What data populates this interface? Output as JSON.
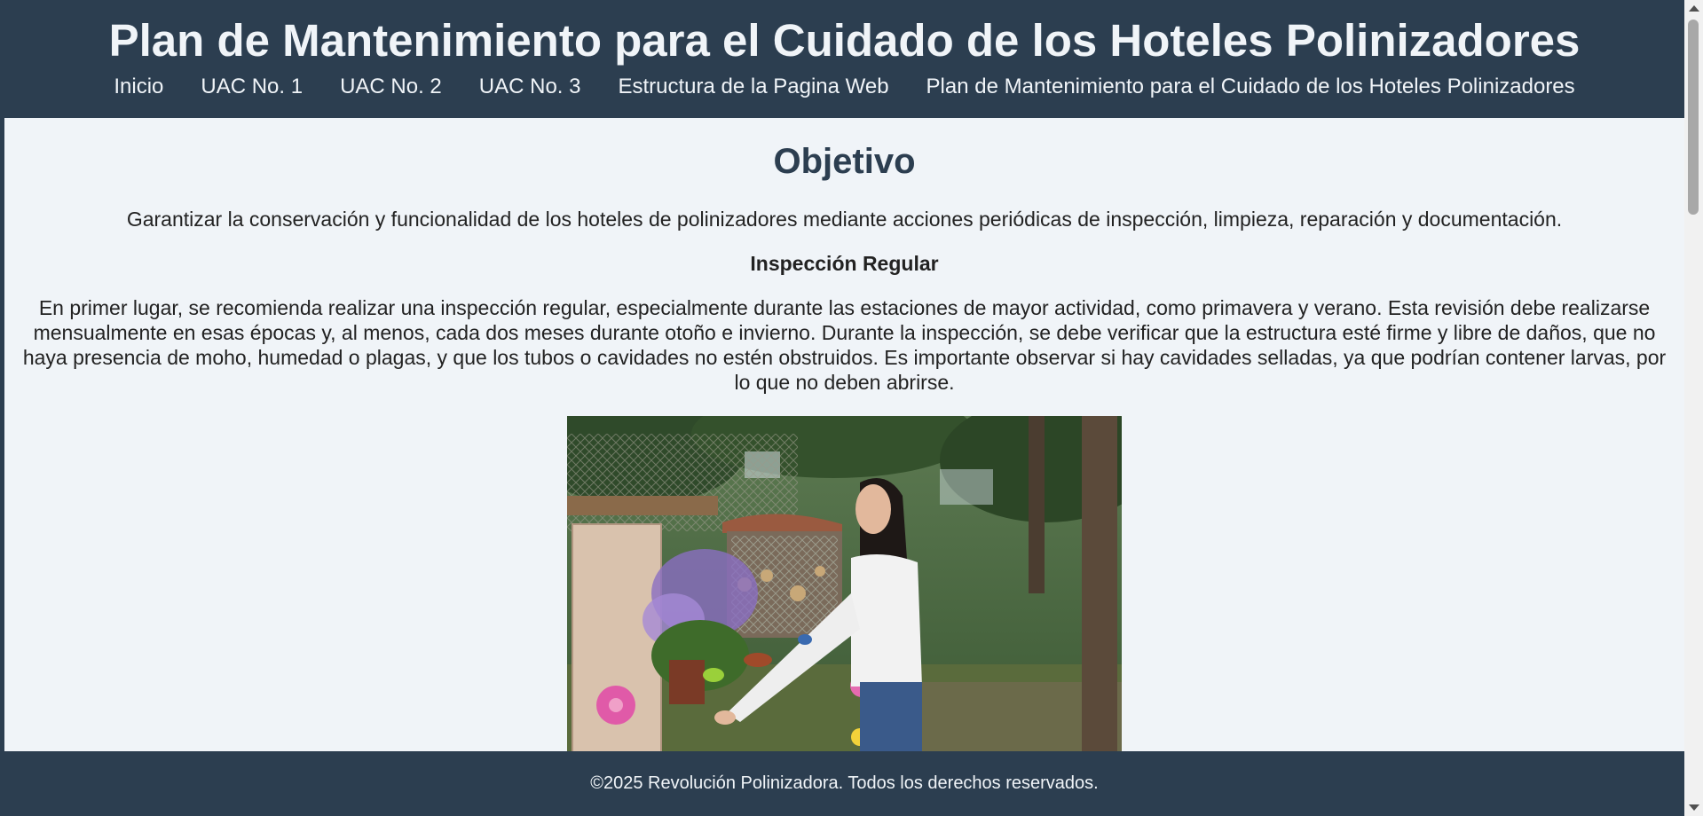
{
  "header": {
    "title": "Plan de Mantenimiento para el Cuidado de los Hoteles Polinizadores",
    "nav": [
      {
        "label": "Inicio"
      },
      {
        "label": "UAC No. 1"
      },
      {
        "label": "UAC No. 2"
      },
      {
        "label": "UAC No. 3"
      },
      {
        "label": "Estructura de la Pagina Web"
      },
      {
        "label": "Plan de Mantenimiento para el Cuidado de los Hoteles Polinizadores"
      }
    ]
  },
  "main": {
    "section_title": "Objetivo",
    "objective": "Garantizar la conservación y funcionalidad de los hoteles de polinizadores mediante acciones periódicas de inspección, limpieza, reparación y documentación.",
    "subheading": "Inspección Regular",
    "paragraph": "En primer lugar, se recomienda realizar una inspección regular, especialmente durante las estaciones de mayor actividad, como primavera y verano. Esta revisión debe realizarse mensualmente en esas épocas y, al menos, cada dos meses durante otoño e invierno. Durante la inspección, se debe verificar que la estructura esté firme y libre de daños, que no haya presencia de moho, humedad o plagas, y que los tubos o cavidades no estén obstruidos. Es importante observar si hay cavidades selladas, ya que podrían contener larvas, por lo que no deben abrirse."
  },
  "footer": {
    "text": "©2025 Revolución Polinizadora. Todos los derechos reservados."
  },
  "colors": {
    "header_bg": "#2c3e50",
    "page_bg": "#f0f4f8",
    "title_color": "#2c3e50"
  }
}
